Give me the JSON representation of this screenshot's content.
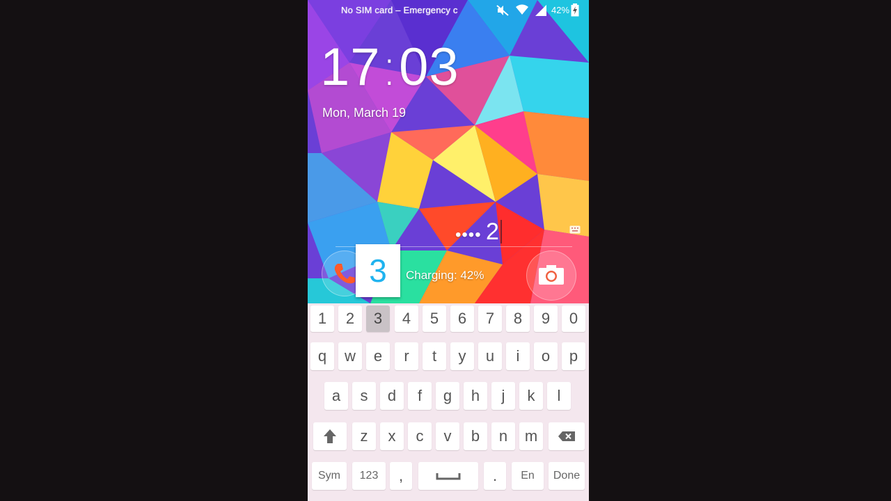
{
  "status_bar": {
    "carrier": "No SIM card – Emergency c",
    "battery_percent": "42%",
    "icons": [
      "mute-icon",
      "wifi-icon",
      "signal-icon",
      "battery-charging-icon"
    ]
  },
  "lock": {
    "time_hours": "17",
    "time_sep": ":",
    "time_minutes": "03",
    "date": "Mon, March 19",
    "password_mask": "••••",
    "password_last_char": "2",
    "charging": "Charging: 42%",
    "key_preview": "3"
  },
  "keyboard": {
    "row_numbers": [
      "1",
      "2",
      "3",
      "4",
      "5",
      "6",
      "7",
      "8",
      "9",
      "0"
    ],
    "pressed_key": "3",
    "row1": [
      "q",
      "w",
      "e",
      "r",
      "t",
      "y",
      "u",
      "i",
      "o",
      "p"
    ],
    "row2": [
      "a",
      "s",
      "d",
      "f",
      "g",
      "h",
      "j",
      "k",
      "l"
    ],
    "row3": [
      "z",
      "x",
      "c",
      "v",
      "b",
      "n",
      "m"
    ],
    "bottom": {
      "sym": "Sym",
      "num": "123",
      "comma": ",",
      "period": ".",
      "lang": "En",
      "done": "Done"
    }
  }
}
